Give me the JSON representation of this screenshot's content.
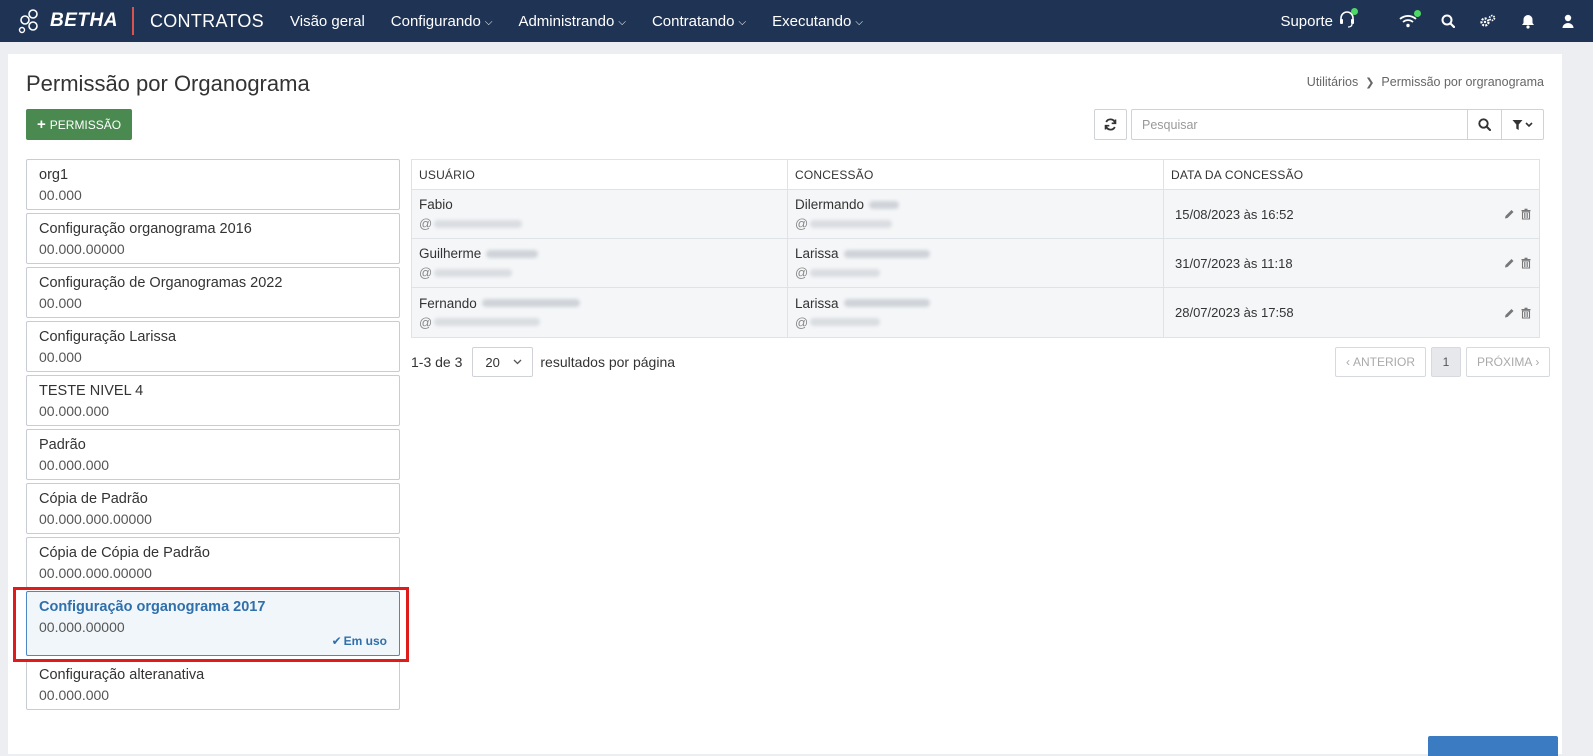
{
  "nav": {
    "brand": "BETHA",
    "app": "CONTRATOS",
    "menu": [
      {
        "label": "Visão geral",
        "dropdown": false
      },
      {
        "label": "Configurando",
        "dropdown": true
      },
      {
        "label": "Administrando",
        "dropdown": true
      },
      {
        "label": "Contratando",
        "dropdown": true
      },
      {
        "label": "Executando",
        "dropdown": true
      }
    ],
    "support_label": "Suporte",
    "icons": [
      "headset-icon",
      "wifi-icon",
      "search-icon",
      "settings-icon",
      "bell-icon",
      "user-icon"
    ]
  },
  "page": {
    "title": "Permissão por Organograma",
    "breadcrumb": [
      "Utilitários",
      "Permissão por orgranograma"
    ],
    "add_button": "PERMISSÃO",
    "search_placeholder": "Pesquisar"
  },
  "organograms": [
    {
      "name": "org1",
      "code": "00.000"
    },
    {
      "name": "Configuração organograma 2016",
      "code": "00.000.00000"
    },
    {
      "name": "Configuração de Organogramas 2022",
      "code": "00.000"
    },
    {
      "name": "Configuração Larissa",
      "code": "00.000"
    },
    {
      "name": "TESTE NIVEL 4",
      "code": "00.000.000"
    },
    {
      "name": "Padrão",
      "code": "00.000.000"
    },
    {
      "name": "Cópia de Padrão",
      "code": "00.000.000.00000"
    },
    {
      "name": "Cópia de Cópia de Padrão",
      "code": "00.000.000.00000"
    },
    {
      "name": "Configuração organograma 2017",
      "code": "00.000.00000",
      "active": true,
      "status": "Em uso"
    },
    {
      "name": "Configuração alteranativa",
      "code": "00.000.000"
    }
  ],
  "table": {
    "headers": [
      "USUÁRIO",
      "CONCESSÃO",
      "DATA DA CONCESSÃO"
    ],
    "rows": [
      {
        "user": "Fabio",
        "user_handle": "@",
        "grantor": "Dilermando",
        "grantor_handle": "@",
        "date": "15/08/2023 às 16:52"
      },
      {
        "user": "Guilherme",
        "user_handle": "@",
        "grantor": "Larissa",
        "grantor_handle": "@",
        "date": "31/07/2023 às 11:18"
      },
      {
        "user": "Fernando",
        "user_handle": "@",
        "grantor": "Larissa",
        "grantor_handle": "@",
        "date": "28/07/2023 às 17:58"
      }
    ]
  },
  "pagination": {
    "range": "1-3 de 3",
    "page_size": "20",
    "per_page_label": "resultados por página",
    "prev": "ANTERIOR",
    "current": "1",
    "next": "PRÓXIMA"
  },
  "colors": {
    "navbar": "#1f3454",
    "primary_green": "#4a8a50",
    "active_blue": "#2f6fab",
    "highlight_red": "#e01b1b"
  }
}
